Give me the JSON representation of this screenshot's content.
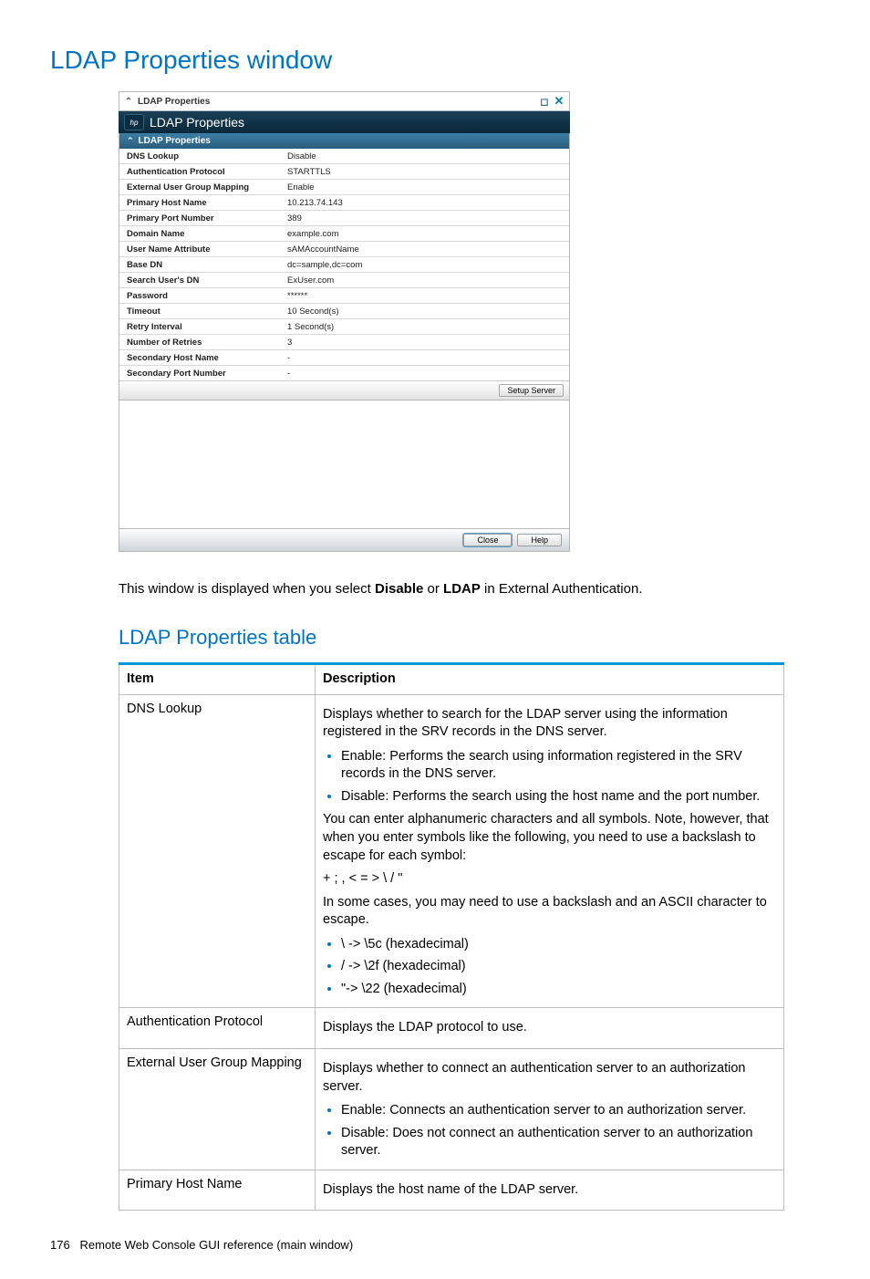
{
  "page": {
    "section_title": "LDAP Properties window",
    "subsection_title": "LDAP Properties table",
    "body_text_pre": "This window is displayed when you select ",
    "body_b1": "Disable",
    "body_or": " or ",
    "body_b2": "LDAP",
    "body_text_post": " in External Authentication.",
    "footer_num": "176",
    "footer_text": "Remote Web Console GUI reference (main window)"
  },
  "window": {
    "title": "LDAP Properties",
    "banner_title": "LDAP Properties",
    "hp_logo_text": "hp",
    "inner_header": "LDAP Properties",
    "setup_button": "Setup Server",
    "close_button": "Close",
    "help_button": "Help",
    "rows": [
      {
        "key": "DNS Lookup",
        "val": "Disable"
      },
      {
        "key": "Authentication Protocol",
        "val": "STARTTLS"
      },
      {
        "key": "External User Group Mapping",
        "val": "Enable"
      },
      {
        "key": "Primary Host Name",
        "val": "10.213.74.143"
      },
      {
        "key": "Primary Port Number",
        "val": "389"
      },
      {
        "key": "Domain Name",
        "val": "example.com"
      },
      {
        "key": "User Name Attribute",
        "val": "sAMAccountName"
      },
      {
        "key": "Base DN",
        "val": "dc=sample,dc=com"
      },
      {
        "key": "Search User's DN",
        "val": "ExUser.com"
      },
      {
        "key": "Password",
        "val": "******"
      },
      {
        "key": "Timeout",
        "val": "10 Second(s)"
      },
      {
        "key": "Retry Interval",
        "val": "1 Second(s)"
      },
      {
        "key": "Number of Retries",
        "val": "3"
      },
      {
        "key": "Secondary Host Name",
        "val": "-"
      },
      {
        "key": "Secondary Port Number",
        "val": "-"
      }
    ]
  },
  "table": {
    "head_item": "Item",
    "head_desc": "Description",
    "rows": [
      {
        "item": "DNS Lookup",
        "desc": {
          "p1": "Displays whether to search for the LDAP server using the information registered in the SRV records in the DNS server.",
          "b1": "Enable: Performs the search using information registered in the SRV records in the DNS server.",
          "b2": "Disable: Performs the search using the host name and the port number.",
          "p2": "You can enter alphanumeric characters and all symbols. Note, however, that when you enter symbols like the following, you need to use a backslash to escape for each symbol:",
          "sym": "+ ; , < = > \\ / \"",
          "p3": "In some cases, you may need to use a backslash and an ASCII character to escape.",
          "e1": "\\ -> \\5c (hexadecimal)",
          "e2": "/ -> \\2f (hexadecimal)",
          "e3": "\"-> \\22 (hexadecimal)"
        }
      },
      {
        "item": "Authentication Protocol",
        "desc": {
          "p1": "Displays the LDAP protocol to use."
        }
      },
      {
        "item": "External User Group Mapping",
        "desc": {
          "p1": "Displays whether to connect an authentication server to an authorization server.",
          "b1": "Enable: Connects an authentication server to an authorization server.",
          "b2": "Disable: Does not connect an authentication server to an authorization server."
        }
      },
      {
        "item": "Primary Host Name",
        "desc": {
          "p1": "Displays the host name of the LDAP server."
        }
      }
    ]
  }
}
